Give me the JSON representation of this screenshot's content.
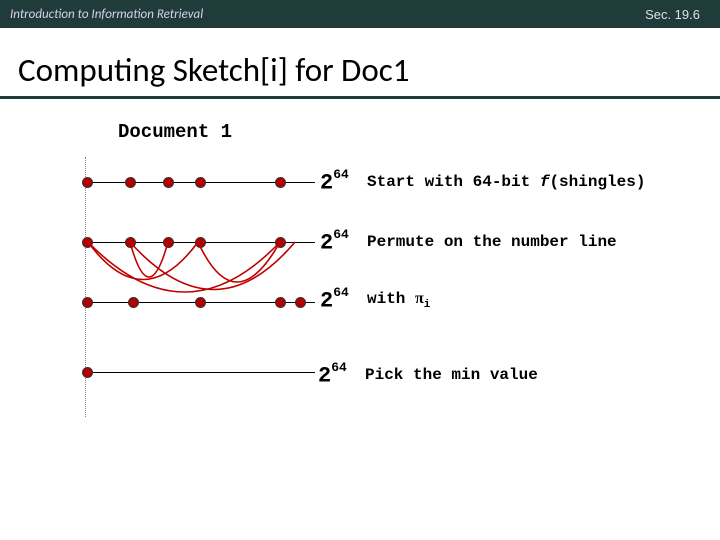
{
  "header": {
    "left": "Introduction to Information Retrieval",
    "right": "Sec. 19.6"
  },
  "title": "Computing Sketch[i] for Doc1",
  "doc_label": "Document 1",
  "power_base": "2",
  "power_exp": "64",
  "steps": {
    "s1_a": "Start with 64-bit ",
    "s1_b": "f",
    "s1_c": "(shingles)",
    "s2": "Permute on the number line",
    "s3_a": "with ",
    "s3_pi": "π",
    "s3_sub": "i",
    "s4": "Pick the min value"
  }
}
